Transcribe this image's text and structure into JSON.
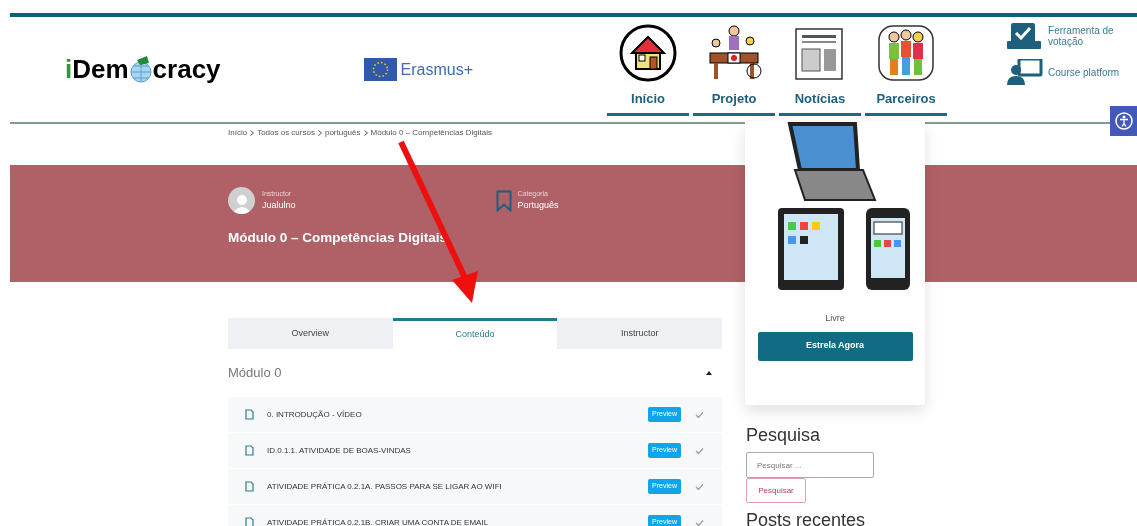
{
  "header": {
    "logo": {
      "before": "iDem",
      "after": "cracy"
    },
    "partner": "Erasmus+",
    "nav": [
      {
        "label": "Início",
        "kind": "home"
      },
      {
        "label": "Projeto",
        "kind": "project"
      },
      {
        "label": "Notícias",
        "kind": "news"
      },
      {
        "label": "Parceiros",
        "kind": "partners"
      }
    ],
    "tools": [
      {
        "label": "Ferramenta de votação",
        "kind": "vote"
      },
      {
        "label": "Course platform",
        "kind": "course"
      }
    ]
  },
  "breadcrumb": [
    "Início",
    "Todos os cursos",
    "português",
    "Módulo 0 – Competências Digitais"
  ],
  "course": {
    "instructor_label": "Instructor",
    "instructor": "Jualulno",
    "category_label": "Categoria",
    "category": "Português",
    "title": "Módulo 0 – Competências Digitais"
  },
  "tabs": [
    {
      "label": "Overview",
      "selected": false
    },
    {
      "label": "Conteúdo",
      "selected": true
    },
    {
      "label": "Instructor",
      "selected": false
    }
  ],
  "section": {
    "title": "Módulo 0",
    "expanded": true
  },
  "lessons": [
    {
      "title": "0. INTRODUÇÃO - VÍDEO",
      "badge": "Preview"
    },
    {
      "title": "ID.0.1.1. ATIVIDADE DE BOAS-VINDAS",
      "badge": "Preview"
    },
    {
      "title": "ATIVIDADE PRÁTICA 0.2.1A. PASSOS PARA SE LIGAR AO WIFI",
      "badge": "Preview"
    },
    {
      "title": "ATIVIDADE PRÁTICA 0.2.1B. CRIAR UMA CONTA DE EMAIL",
      "badge": "Preview"
    }
  ],
  "sidebar": {
    "price": "Livre",
    "button": "Estrela Agora",
    "search_title": "Pesquisa",
    "search": {
      "placeholder": "Pesquisar ..."
    },
    "search_button": "Pesquisar",
    "recent_title": "Posts recentes"
  }
}
